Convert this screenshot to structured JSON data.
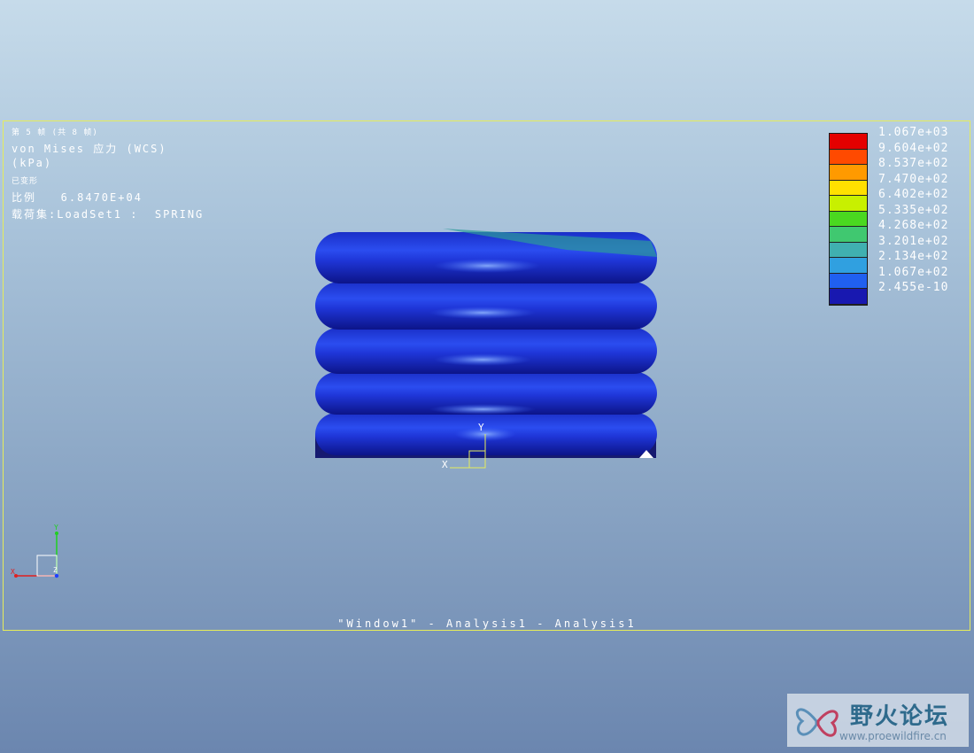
{
  "info": {
    "frame": "第 5 帧 (共 8 帧)",
    "quantity": "von Mises 应力 (WCS)",
    "unit": "(kPa)",
    "deformed": "已变形",
    "scale": "比例   6.8470E+04",
    "load_set": "载荷集:LoadSet1 :  SPRING"
  },
  "legend": {
    "ticks": [
      "1.067e+03",
      "9.604e+02",
      "8.537e+02",
      "7.470e+02",
      "6.402e+02",
      "5.335e+02",
      "4.268e+02",
      "3.201e+02",
      "2.134e+02",
      "1.067e+02",
      "2.455e-10"
    ],
    "colors": [
      "#e40000",
      "#ff4a00",
      "#ff9a00",
      "#ffe000",
      "#c8f000",
      "#4ad820",
      "#40c870",
      "#40b0b0",
      "#30a0e0",
      "#2060f0",
      "#1818b0"
    ]
  },
  "model_axes": {
    "x": "X",
    "y": "Y"
  },
  "triad": {
    "x": "X",
    "y": "Y",
    "z": "Z"
  },
  "window_title": "\"Window1\" - Analysis1 - Analysis1",
  "watermark": {
    "name": "野火论坛",
    "url": "www.proewildfire.cn"
  }
}
